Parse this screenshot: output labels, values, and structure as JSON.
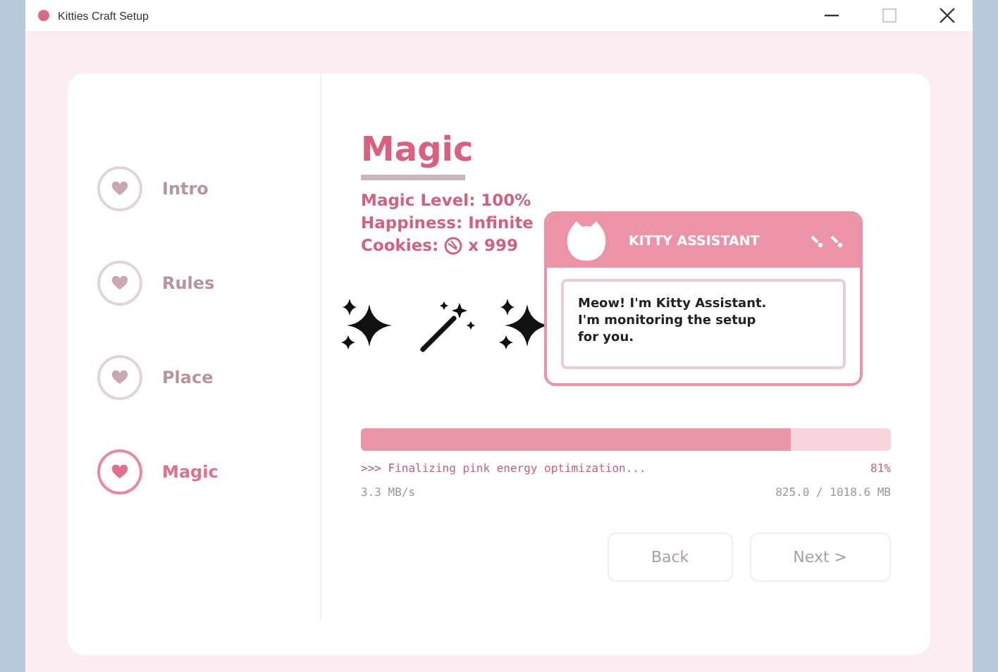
{
  "window": {
    "title": "Kitties Craft Setup"
  },
  "steps": [
    {
      "label": "Intro",
      "selected": false
    },
    {
      "label": "Rules",
      "selected": false
    },
    {
      "label": "Place",
      "selected": false
    },
    {
      "label": "Magic",
      "selected": true
    }
  ],
  "heading": "Magic",
  "stats": [
    "Magic Level: 100%",
    "Happiness: Infinite",
    "Cookies:",
    "x 999"
  ],
  "assistant": {
    "title": "KITTY ASSISTANT",
    "message": "Meow! I'm Kitty Assistant. I'm monitoring the setup for you."
  },
  "progress": {
    "level": 0.81,
    "status": ">>> Finalizing pink energy optimization...",
    "percent": "81%",
    "speed": "3.3 MB/s",
    "size": "825.0 / 1018.6 MB"
  },
  "buttons": [
    {
      "label": "Back",
      "disabled": true
    },
    {
      "label": "Next >",
      "disabled": true
    }
  ]
}
